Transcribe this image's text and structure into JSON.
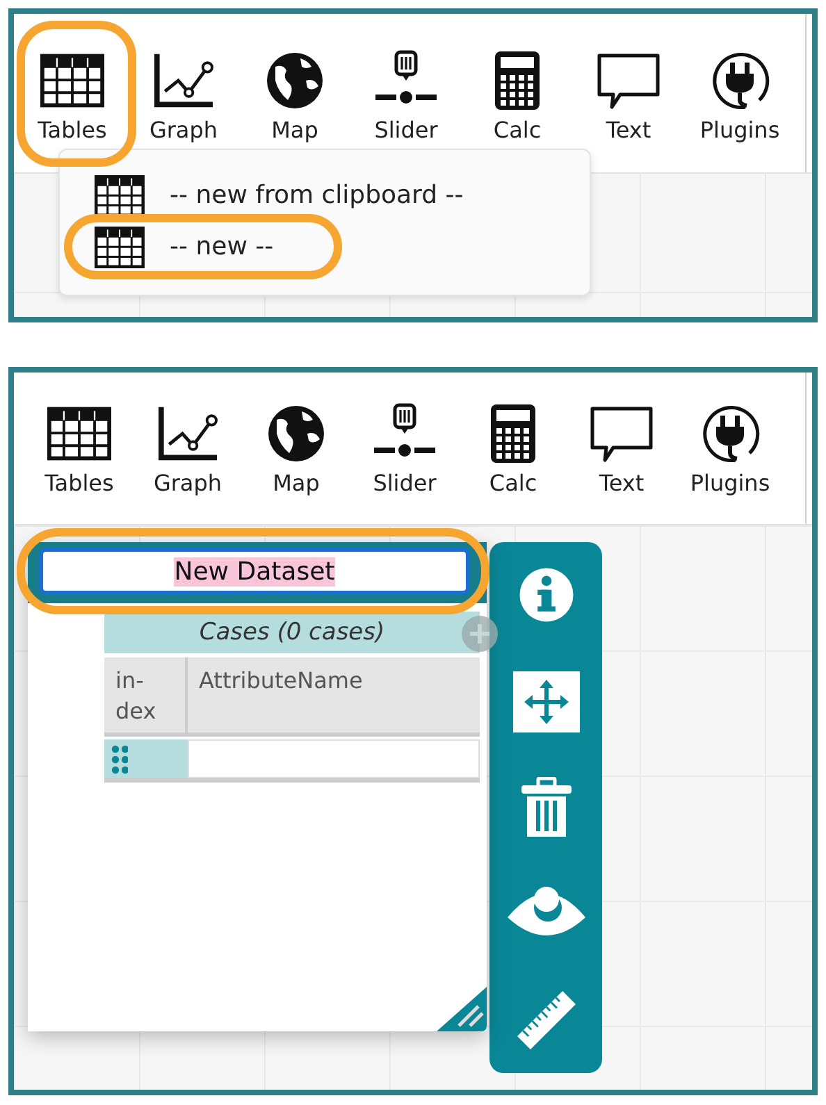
{
  "panels": [
    {
      "toolbar": [
        {
          "kind": "tables",
          "label": "Tables",
          "highlighted": true
        },
        {
          "kind": "graph",
          "label": "Graph",
          "highlighted": false
        },
        {
          "kind": "map",
          "label": "Map",
          "highlighted": false
        },
        {
          "kind": "slider",
          "label": "Slider",
          "highlighted": false
        },
        {
          "kind": "calc",
          "label": "Calc",
          "highlighted": false
        },
        {
          "kind": "text",
          "label": "Text",
          "highlighted": false
        },
        {
          "kind": "plugins",
          "label": "Plugins",
          "highlighted": false
        }
      ],
      "menu": [
        {
          "label": "-- new from clipboard --",
          "highlighted": false
        },
        {
          "label": "-- new --",
          "highlighted": true
        }
      ]
    },
    {
      "toolbar": [
        {
          "kind": "tables",
          "label": "Tables",
          "highlighted": false
        },
        {
          "kind": "graph",
          "label": "Graph",
          "highlighted": false
        },
        {
          "kind": "map",
          "label": "Map",
          "highlighted": false
        },
        {
          "kind": "slider",
          "label": "Slider",
          "highlighted": false
        },
        {
          "kind": "calc",
          "label": "Calc",
          "highlighted": false
        },
        {
          "kind": "text",
          "label": "Text",
          "highlighted": false
        },
        {
          "kind": "plugins",
          "label": "Plugins",
          "highlighted": false
        }
      ],
      "table": {
        "title": "New Dataset",
        "title_highlighted": true,
        "text_selected": true,
        "collection": "Cases (0 cases)",
        "columns": [
          "in-dex",
          "AttributeName"
        ]
      }
    }
  ]
}
